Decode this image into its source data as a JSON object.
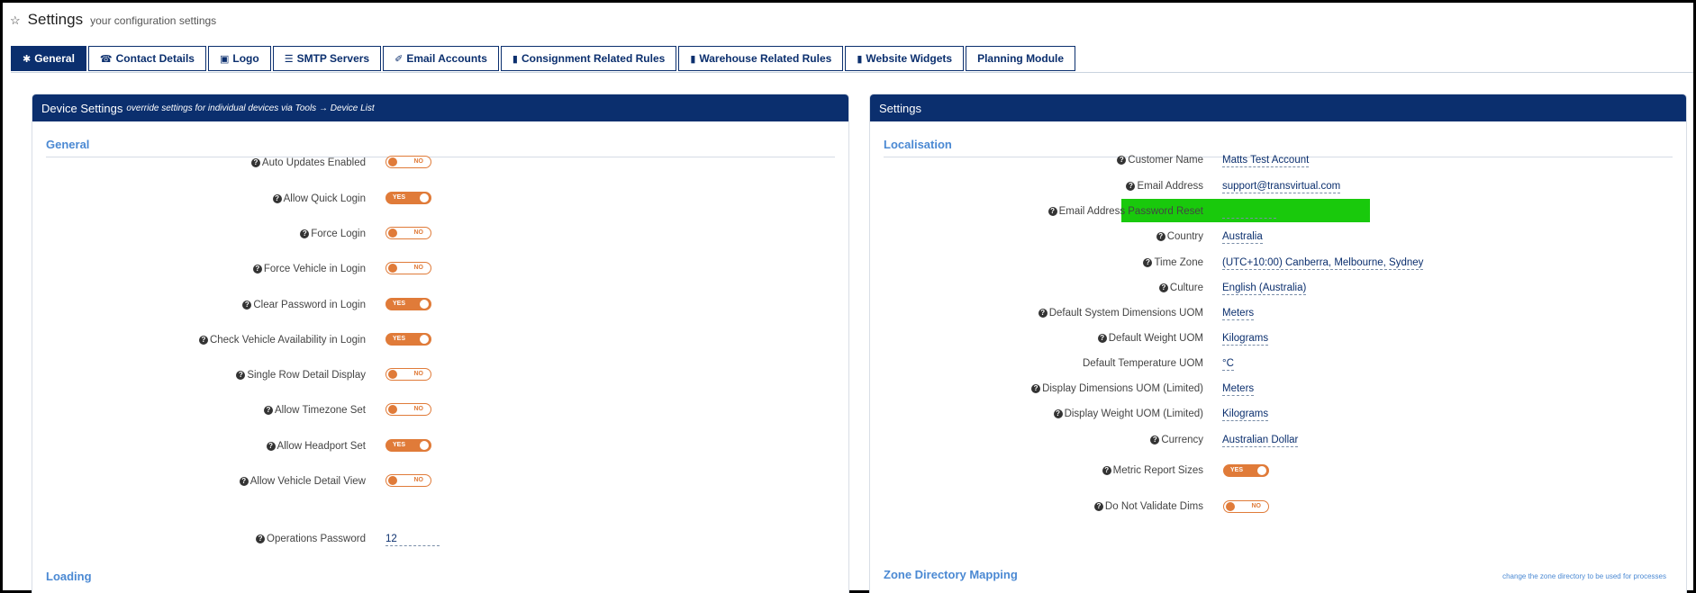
{
  "header": {
    "title": "Settings",
    "subtitle": "your configuration settings"
  },
  "tabs": [
    {
      "label": "General",
      "icon": "✱"
    },
    {
      "label": "Contact Details",
      "icon": "☎"
    },
    {
      "label": "Logo",
      "icon": "▣"
    },
    {
      "label": "SMTP Servers",
      "icon": "☰"
    },
    {
      "label": "Email Accounts",
      "icon": "✐"
    },
    {
      "label": "Consignment Related Rules",
      "icon": "▮"
    },
    {
      "label": "Warehouse Related Rules",
      "icon": "▮"
    },
    {
      "label": "Website Widgets",
      "icon": "▮"
    },
    {
      "label": "Planning Module",
      "icon": ""
    }
  ],
  "left_panel": {
    "title": "Device Settings",
    "subtitle": "override settings for individual devices via Tools → Device List",
    "section_general": "General",
    "section_loading": "Loading",
    "toggles": [
      {
        "label": "Auto Updates Enabled",
        "state": "NO"
      },
      {
        "label": "Allow Quick Login",
        "state": "YES"
      },
      {
        "label": "Force Login",
        "state": "NO"
      },
      {
        "label": "Force Vehicle in Login",
        "state": "NO"
      },
      {
        "label": "Clear Password in Login",
        "state": "YES"
      },
      {
        "label": "Check Vehicle Availability in Login",
        "state": "YES"
      },
      {
        "label": "Single Row Detail Display",
        "state": "NO"
      },
      {
        "label": "Allow Timezone Set",
        "state": "NO"
      },
      {
        "label": "Allow Headport Set",
        "state": "YES"
      },
      {
        "label": "Allow Vehicle Detail View",
        "state": "NO"
      }
    ],
    "operations_password": {
      "label": "Operations Password",
      "value": "12"
    }
  },
  "right_panel": {
    "title": "Settings",
    "section_localisation": "Localisation",
    "section_zone": "Zone Directory Mapping",
    "zone_note": "change the zone directory to be used for processes",
    "fields": [
      {
        "label": "Customer Name",
        "value": "Matts Test Account"
      },
      {
        "label": "Email Address",
        "value": "support@transvirtual.com"
      },
      {
        "label": "Email Address Password Reset",
        "value": ""
      },
      {
        "label": "Country",
        "value": "Australia"
      },
      {
        "label": "Time Zone",
        "value": "(UTC+10:00) Canberra, Melbourne, Sydney"
      },
      {
        "label": "Culture",
        "value": "English (Australia)"
      },
      {
        "label": "Default System Dimensions UOM",
        "value": "Meters"
      },
      {
        "label": "Default Weight UOM",
        "value": "Kilograms"
      },
      {
        "label": "Default Temperature UOM",
        "value": "°C"
      },
      {
        "label": "Display Dimensions UOM (Limited)",
        "value": "Meters"
      },
      {
        "label": "Display Weight UOM (Limited)",
        "value": "Kilograms"
      },
      {
        "label": "Currency",
        "value": "Australian Dollar"
      }
    ],
    "toggles": [
      {
        "label": "Metric Report Sizes",
        "state": "YES"
      },
      {
        "label": "Do Not Validate Dims",
        "state": "NO"
      }
    ]
  },
  "colors": {
    "brand": "#0b2f6e",
    "accent": "#e07b39",
    "highlight": "#19c90c",
    "section": "#4b89d3"
  }
}
